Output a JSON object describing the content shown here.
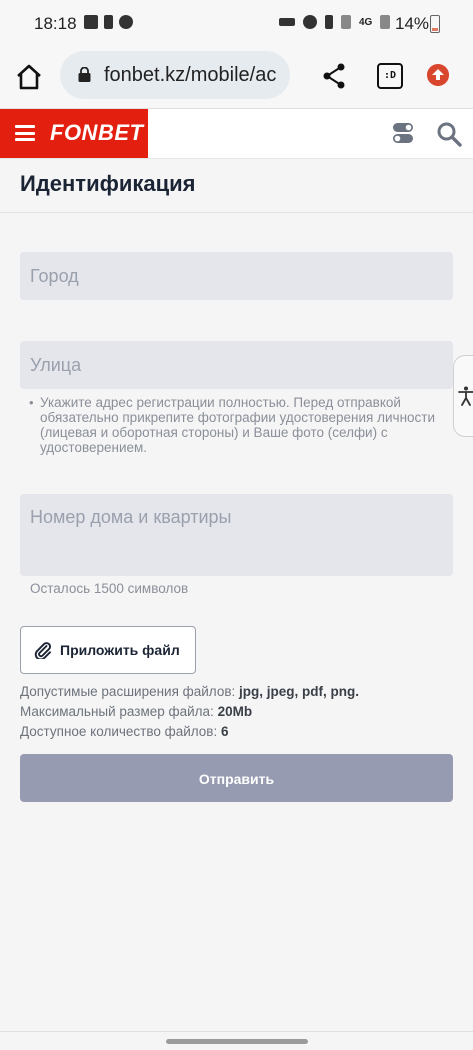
{
  "statusbar": {
    "time": "18:18",
    "battery": "14%",
    "network_label": "4G"
  },
  "browser": {
    "url": "fonbet.kz/mobile/ac",
    "tabs_label": ":D",
    "icons": [
      "home-icon",
      "lock-icon",
      "share-icon",
      "tabs-icon",
      "update-icon"
    ]
  },
  "header": {
    "logo": "FONBET",
    "brand_color": "#e3200f",
    "icons": [
      "menu-icon",
      "toggle-icon",
      "search-icon"
    ]
  },
  "page": {
    "title": "Идентификация",
    "city_placeholder": "Город",
    "street_placeholder": "Улица",
    "address_hint": "Укажите адрес регистрации полностью. Перед отправкой обязательно прикрепите фотографии удостоверения личности (лицевая и оборотная стороны) и Ваше фото (селфи) с удостоверением.",
    "house_placeholder": "Номер дома и квартиры",
    "char_counter": "Осталось 1500 символов",
    "attach_label": "Приложить файл",
    "extensions_label": "Допустимые расширения файлов:",
    "extensions_value": "jpg, jpeg, pdf, png.",
    "max_size_label": "Максимальный размер файла:",
    "max_size_value": "20Mb",
    "files_count_label": "Доступное количество файлов:",
    "files_count_value": "6",
    "submit_label": "Отправить",
    "submit_color": "#969bb1"
  }
}
